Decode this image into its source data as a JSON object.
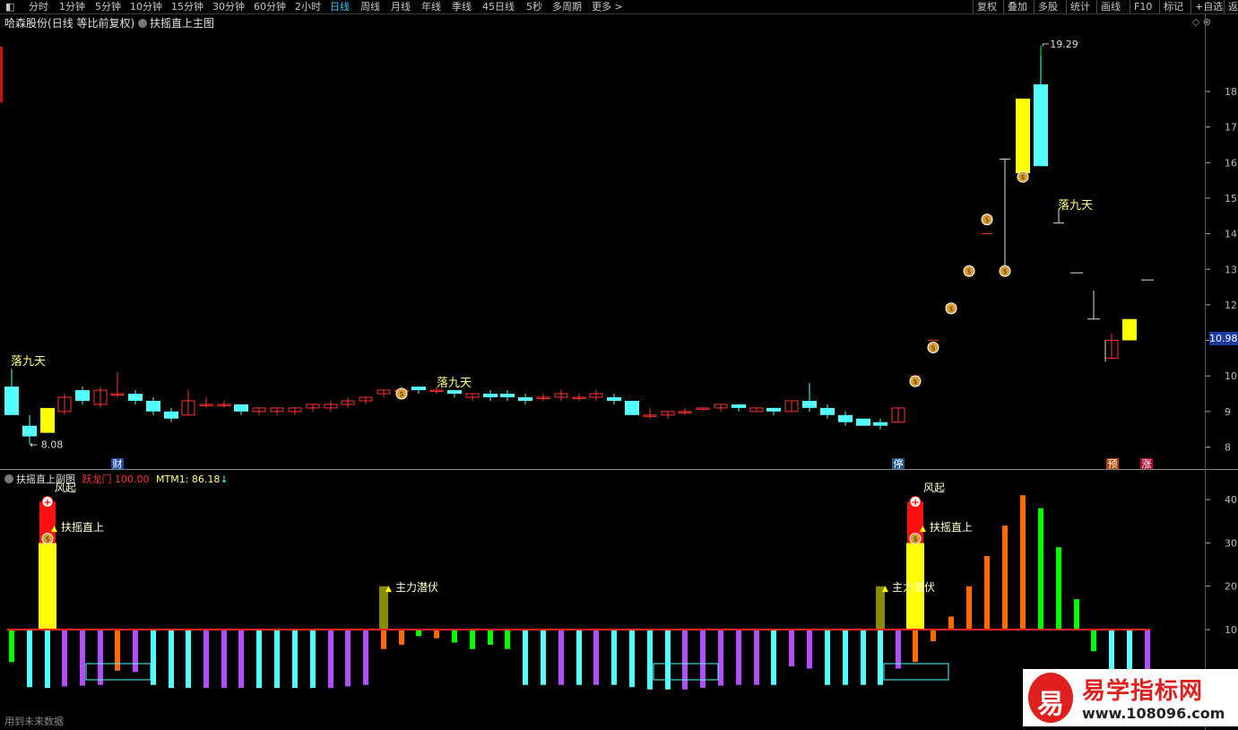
{
  "toolbar": {
    "left_items": [
      "分时",
      "1分钟",
      "5分钟",
      "10分钟",
      "15分钟",
      "30分钟",
      "60分钟",
      "2小时",
      "日线",
      "周线",
      "月线",
      "年线",
      "季线",
      "45日线",
      "5秒",
      "多周期",
      "更多 >"
    ],
    "active": "日线",
    "right_items": [
      "复权",
      "叠加",
      "多股",
      "统计",
      "画线",
      "F10",
      "标记",
      "+自选",
      "返"
    ]
  },
  "main_chart": {
    "stock": "哈森股份",
    "mode": "(日线 等比前复权)",
    "indicator": "扶摇直上主图",
    "y_ticks": [
      "18",
      "17",
      "16",
      "15",
      "14",
      "13",
      "12",
      "11",
      "10",
      "9",
      "8"
    ],
    "current_price": "10.98",
    "high_label": "19.29",
    "low_label": "8.08",
    "annotations": [
      "落九天",
      "落九天",
      "落九天"
    ],
    "event_tags": [
      "财",
      "停",
      "预",
      "涨"
    ]
  },
  "sub_chart": {
    "indicator": "扶摇直上副图",
    "label1": "跃龙门",
    "label1_value": "100.00",
    "label2": "MTM1:",
    "label2_value": "86.18",
    "arrow": "↓",
    "y_ticks": [
      "40",
      "30",
      "20",
      "10"
    ],
    "signals": [
      "扶摇直上",
      "扶摇直上",
      "主力潜伏",
      "主力潜伏",
      "风起",
      "风起"
    ]
  },
  "status": "用到未来数据",
  "watermark": {
    "title": "易学指标网",
    "url": "www.108096.com",
    "logo_char": "易"
  },
  "colors": {
    "up": "#ff3232",
    "down": "#54ffff",
    "yellow": "#ffff00",
    "green": "#00ff00",
    "orange": "#ff6a00",
    "purple": "#b44cff",
    "olive": "#8b8b00",
    "cyan": "#54ffff",
    "label": "#ffff80"
  }
}
